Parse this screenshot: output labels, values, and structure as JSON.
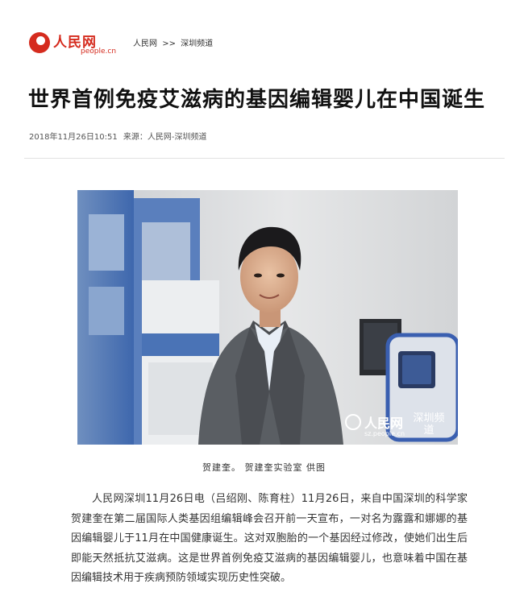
{
  "site": {
    "logo_text": "人民网",
    "logo_url": "people.cn"
  },
  "breadcrumb": {
    "home": "人民网",
    "separator": ">>",
    "channel": "深圳频道"
  },
  "article": {
    "title": "世界首例免疫艾滋病的基因编辑婴儿在中国诞生",
    "datetime": "2018年11月26日10:51",
    "source": "来源：人民网-深圳频道",
    "photo_caption": "贺建奎。   贺建奎实验室 供图",
    "body": "人民网深圳11月26日电（吕绍刚、陈育柱）11月26日，来自中国深圳的科学家贺建奎在第二届国际人类基因组编辑峰会召开前一天宣布，一对名为露露和娜娜的基因编辑婴儿于11月在中国健康诞生。这对双胞胎的一个基因经过修改，使她们出生后即能天然抵抗艾滋病。这是世界首例免疫艾滋病的基因编辑婴儿，也意味着中国在基因编辑技术用于疾病预防领域实现历史性突破。"
  },
  "watermark": {
    "name": "人民网",
    "url": "sz.people.cn",
    "channel": "深圳频道"
  },
  "colors": {
    "brand": "#d52b1e",
    "text": "#333333",
    "title": "#111111",
    "divider": "#e1e1e1"
  }
}
